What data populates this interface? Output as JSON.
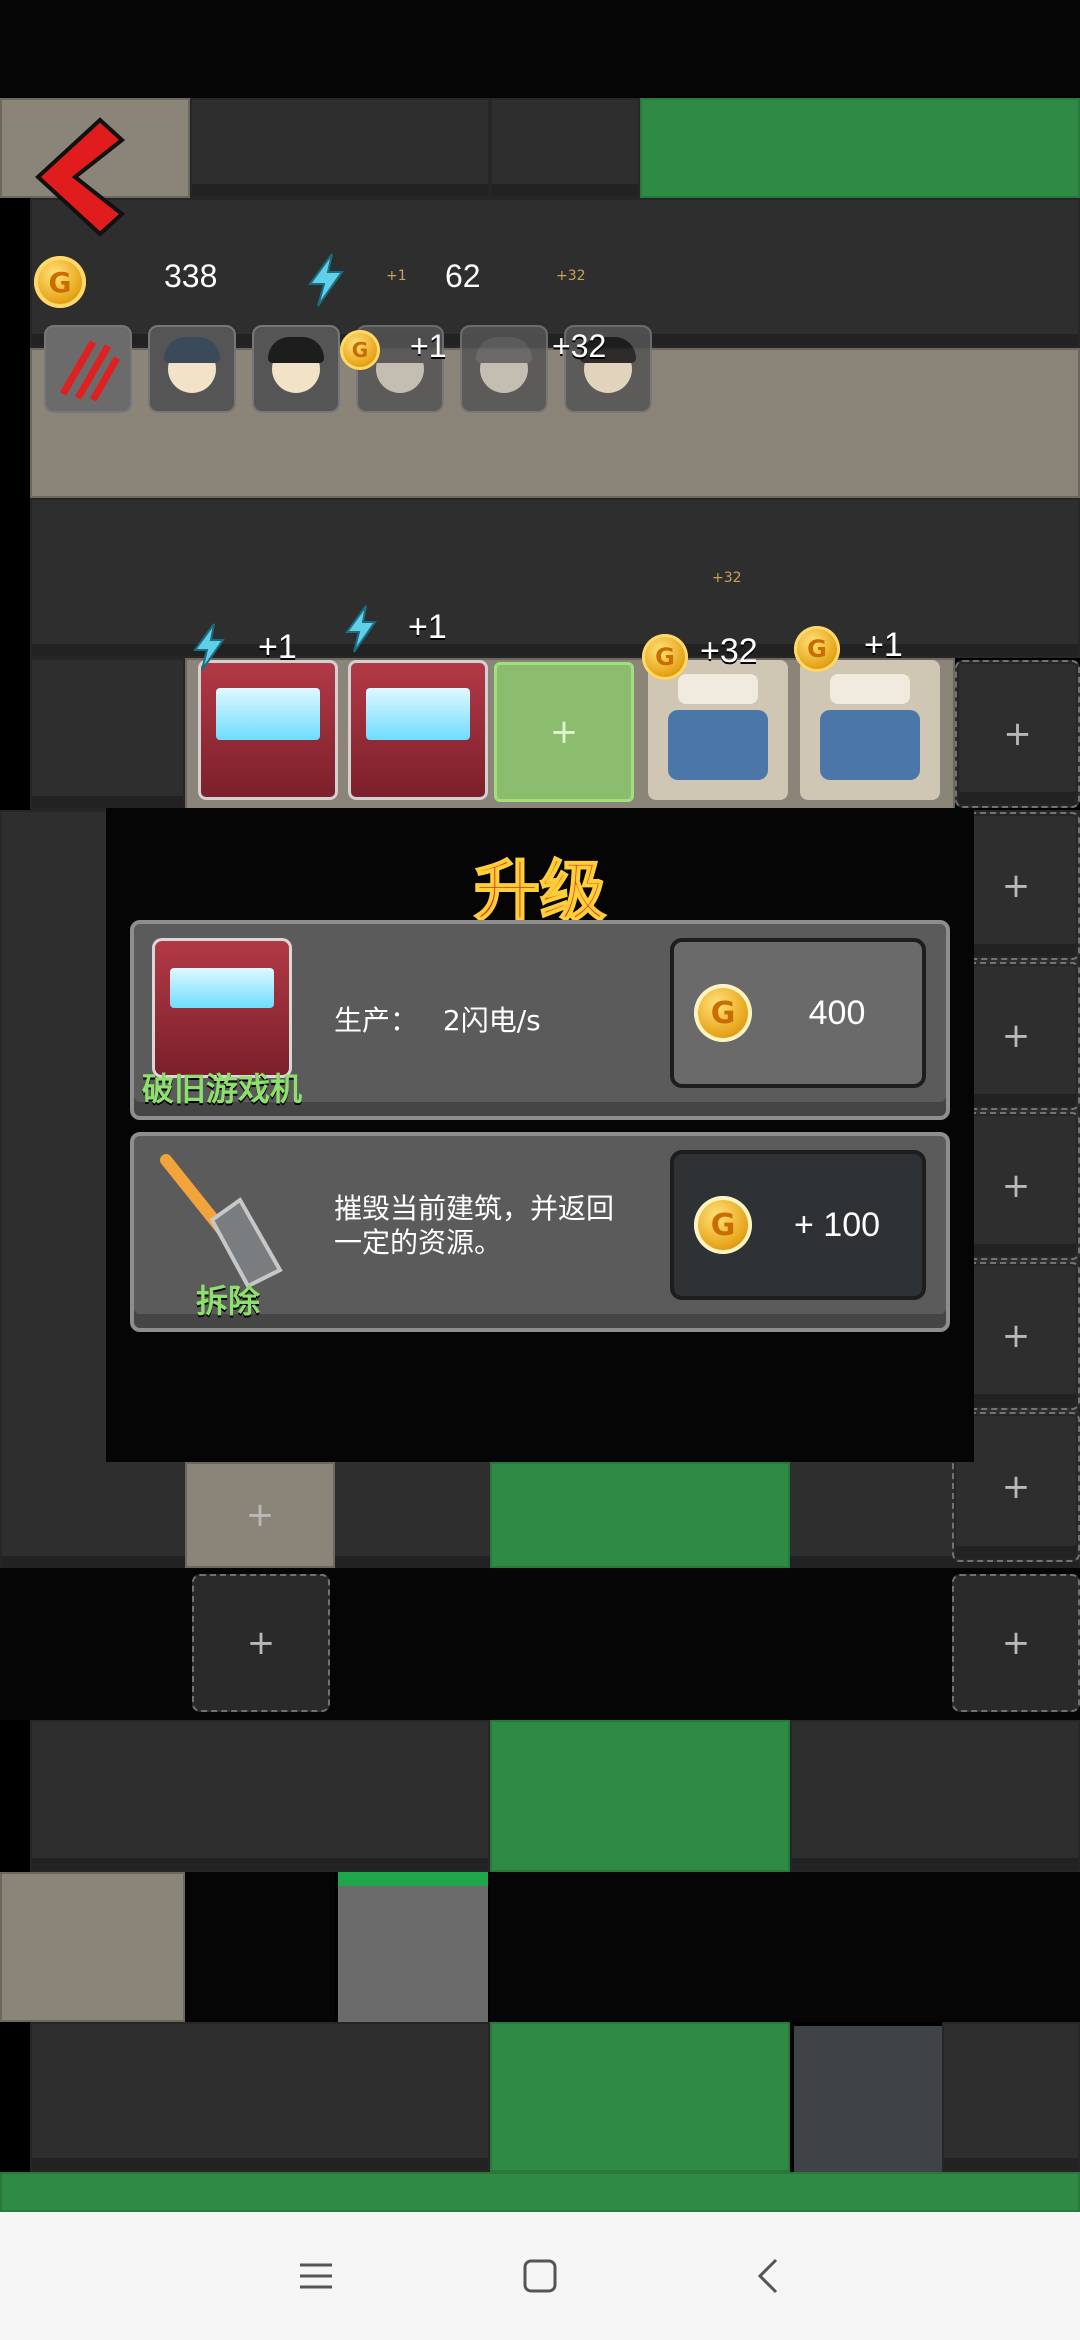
{
  "hud": {
    "gold": "338",
    "energy": "62",
    "mini_gold_1": "+1",
    "mini_gold_2": "+32",
    "mini_gold_3": "+32"
  },
  "avatars": [
    "claw-badge",
    "boy-head",
    "girl-head",
    "gray-girl-head",
    "gray-head",
    "girl-head-2"
  ],
  "avatar_overlays": {
    "coin_plus": "+1",
    "plus_32": "+32"
  },
  "row_labels": {
    "arcade_1": "+1",
    "arcade_2": "+1",
    "bed_1": "+32",
    "bed_2": "+1",
    "empty_slot": "+"
  },
  "modal": {
    "title": "升级",
    "upgrade_card": {
      "name": "破旧游戏机",
      "label": "生产：",
      "value": "2闪电/s",
      "price": "400"
    },
    "demolish_card": {
      "name": "拆除",
      "description_line1": "摧毁当前建筑，并返回",
      "description_line2": "一定的资源。",
      "refund": "+ 100"
    }
  },
  "slot_plus": "+",
  "coin_letter": "G",
  "colors": {
    "title_red": "#e22b1f",
    "title_outline": "#ffcf3a",
    "name_green": "#8ee06c",
    "grass": "#2f8a45"
  }
}
